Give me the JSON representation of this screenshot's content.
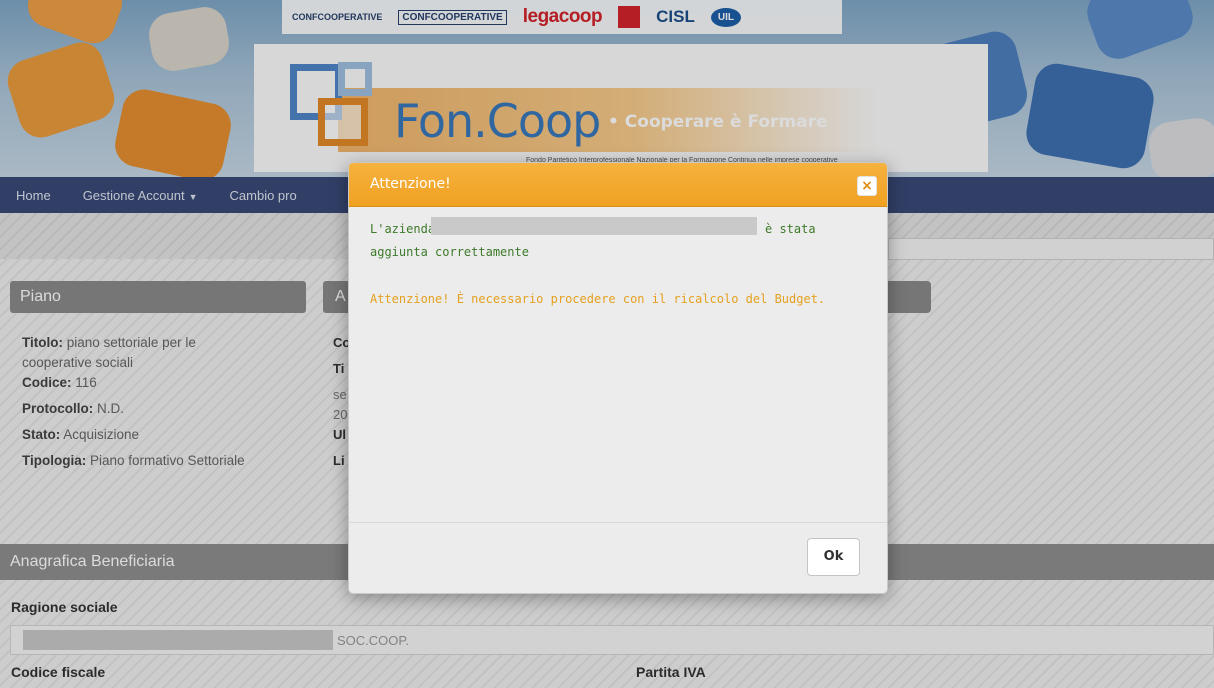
{
  "header": {
    "logos": {
      "confcooperative_small": "CONFCOOPERATIVE",
      "confcooperative": "CONFCOOPERATIVE",
      "legacoop": "legacoop",
      "cisl": "CISL",
      "uil": "UIL"
    },
    "brand": "Fon.Coop",
    "tagline": "• Cooperare è Formare",
    "subtitle": "Fondo Paritetico Interprofessionale Nazionale per la Formazione Continua nelle imprese cooperative"
  },
  "navbar": {
    "items": [
      {
        "label": "Home"
      },
      {
        "label": "Gestione Account",
        "dropdown": true
      },
      {
        "label": "Cambio pro"
      }
    ]
  },
  "panels": {
    "piano": {
      "title": "Piano",
      "rows": [
        {
          "label": "Titolo:",
          "value": "piano settoriale per le"
        },
        {
          "label": "",
          "value": "cooperative sociali"
        },
        {
          "label": "Codice:",
          "value": "116"
        },
        {
          "label": "Protocollo:",
          "value": "N.D."
        },
        {
          "label": "Stato:",
          "value": "Acquisizione"
        },
        {
          "label": "Tipologia:",
          "value": "Piano formativo Settoriale"
        }
      ]
    },
    "second_title_partial": "A",
    "second_rows_partial": [
      "Co",
      "Ti",
      "se",
      "20",
      "Ul",
      "Li"
    ]
  },
  "anagrafica": {
    "title": "Anagrafica Beneficiaria",
    "ragione_sociale_label": "Ragione sociale",
    "ragione_sociale_suffix": "SOC.COOP.",
    "codice_fiscale_label": "Codice fiscale",
    "partita_iva_label": "Partita IVA"
  },
  "modal": {
    "title": "Attenzione!",
    "close_glyph": "×",
    "success_prefix": "L'azienda",
    "success_suffix": "è stata",
    "success_line2": "aggiunta correttamente",
    "warning": "Attenzione! È necessario procedere con il ricalcolo del Budget.",
    "ok_label": "Ok"
  },
  "colors": {
    "modal_header": "#f0a121",
    "navbar": "#3a4a78",
    "success_text": "#3d7a2a",
    "warning_text": "#e5a01f",
    "panel_head": "#8a8a8a"
  }
}
